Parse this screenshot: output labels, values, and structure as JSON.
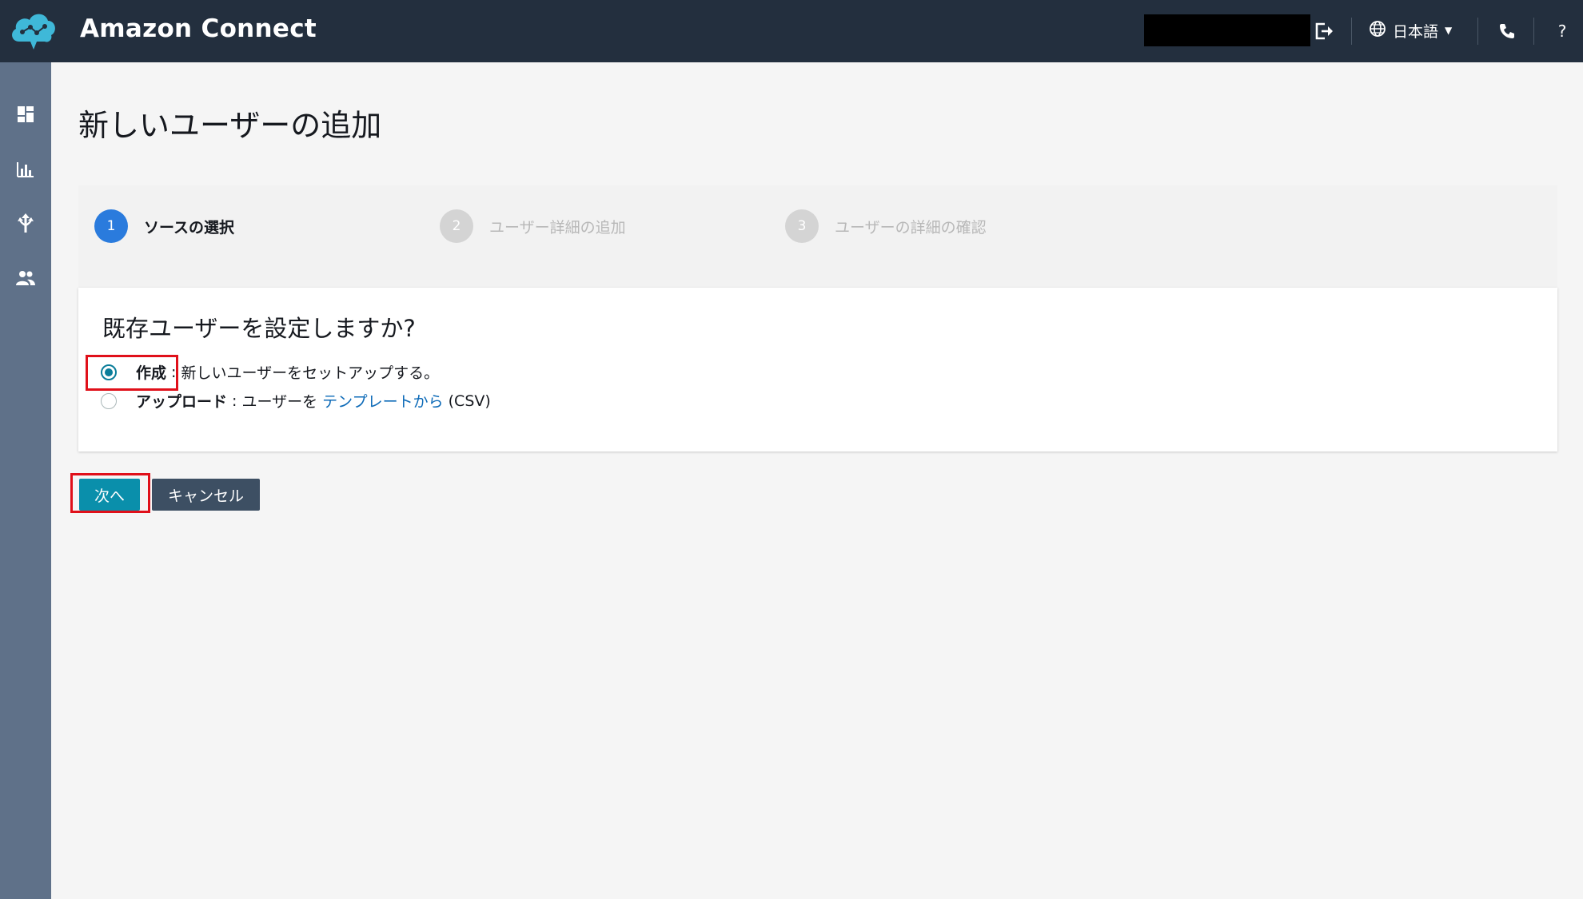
{
  "header": {
    "app_title": "Amazon Connect",
    "language": "日本語",
    "help_label": "?"
  },
  "page": {
    "title": "新しいユーザーの追加"
  },
  "steps": [
    {
      "number": "1",
      "label": "ソースの選択",
      "state": "active"
    },
    {
      "number": "2",
      "label": "ユーザー詳細の追加",
      "state": "inactive"
    },
    {
      "number": "3",
      "label": "ユーザーの詳細の確認",
      "state": "inactive"
    }
  ],
  "source_panel": {
    "question": "既存ユーザーを設定しますか?",
    "options": [
      {
        "label": "作成",
        "separator": " : ",
        "description": "新しいユーザーをセットアップする。",
        "selected": true
      },
      {
        "label": "アップロード",
        "separator": " : ",
        "description_prefix": "ユーザーを ",
        "link_text": "テンプレートから",
        "description_suffix": " (CSV)",
        "selected": false
      }
    ]
  },
  "actions": {
    "next_label": "次へ",
    "cancel_label": "キャンセル"
  },
  "colors": {
    "topbar": "#232f3e",
    "sidebar": "#5f7189",
    "accent": "#0a8fab",
    "step_active": "#2a7bdd",
    "highlight": "#e0101a"
  }
}
